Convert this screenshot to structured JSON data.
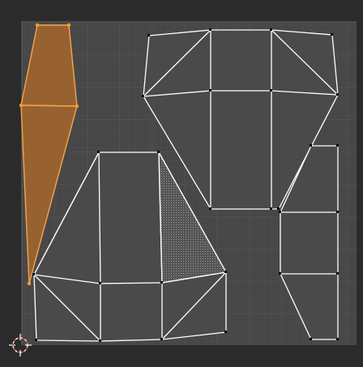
{
  "editor": {
    "view": "UV Editor",
    "background_color": "#2b2b2b",
    "canvas_color": "#474747",
    "grid_minor_color": "#4e4e4e",
    "grid_major_color": "#595959",
    "edge_color": "#ffffff",
    "vertex_color": "#000000",
    "selected_face_color": "#a0652f",
    "selected_edge_color": "#f5a54a",
    "selected_vertex_color": "#ff9a2e",
    "pinned_face_pattern": "dotted",
    "cursor_icon": "2d-cursor-icon"
  },
  "islands": [
    {
      "name": "selected-narrow-strip",
      "selected": true
    },
    {
      "name": "top-right-hexagon-island",
      "selected": false
    },
    {
      "name": "bottom-left-island",
      "selected": false
    },
    {
      "name": "right-side-island",
      "selected": false
    }
  ]
}
